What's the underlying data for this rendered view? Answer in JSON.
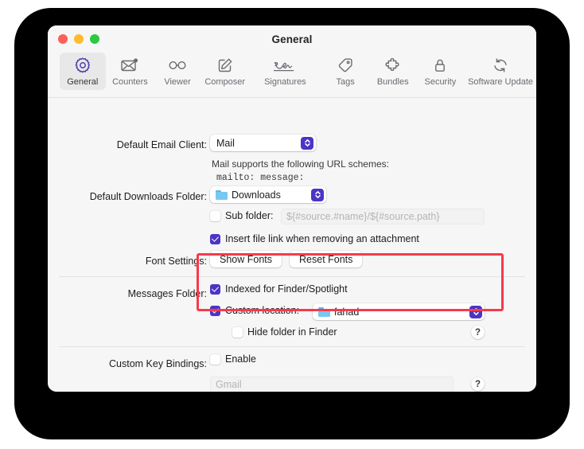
{
  "window": {
    "title": "General",
    "traffic_lights": [
      {
        "name": "close",
        "color": "#fc5f57"
      },
      {
        "name": "minimize",
        "color": "#fdbc2d"
      },
      {
        "name": "zoom",
        "color": "#2bc940"
      }
    ]
  },
  "toolbar": {
    "items": [
      {
        "label": "General",
        "icon": "gear-icon",
        "selected": true
      },
      {
        "label": "Counters",
        "icon": "envelope-badge-icon",
        "selected": false
      },
      {
        "label": "Viewer",
        "icon": "glasses-icon",
        "selected": false
      },
      {
        "label": "Composer",
        "icon": "compose-pencil-icon",
        "selected": false
      },
      {
        "label": "Signatures",
        "icon": "signature-icon",
        "selected": false
      },
      {
        "label": "Tags",
        "icon": "tag-icon",
        "selected": false
      },
      {
        "label": "Bundles",
        "icon": "puzzle-piece-icon",
        "selected": false
      },
      {
        "label": "Security",
        "icon": "lock-icon",
        "selected": false
      },
      {
        "label": "Software Update",
        "icon": "refresh-cycle-icon",
        "selected": false
      }
    ]
  },
  "form": {
    "default_email_client": {
      "label": "Default Email Client:",
      "value": "Mail",
      "note_line1": "Mail supports the following URL schemes:",
      "note_line2": "mailto: message:"
    },
    "default_downloads_folder": {
      "label": "Default Downloads Folder:",
      "value": "Downloads",
      "icon": "folder-icon"
    },
    "sub_folder": {
      "label": "Sub folder:",
      "checked": false,
      "placeholder": "${#source.#name}/${#source.path}"
    },
    "insert_file_link": {
      "label": "Insert file link when removing an attachment",
      "checked": true
    },
    "font_settings": {
      "label": "Font Settings:",
      "show_fonts": "Show Fonts",
      "reset_fonts": "Reset Fonts"
    },
    "messages_folder": {
      "label": "Messages Folder:",
      "indexed": {
        "label": "Indexed for Finder/Spotlight",
        "checked": true
      },
      "custom_location": {
        "label": "Custom location:",
        "checked": true,
        "value": "fahad",
        "icon": "folder-icon"
      },
      "hide_folder": {
        "label": "Hide folder in Finder",
        "checked": false
      },
      "help": "?"
    },
    "custom_key_bindings": {
      "label": "Custom Key Bindings:",
      "enable_label": "Enable",
      "enable_checked": false,
      "placeholder": "Gmail",
      "help": "?"
    }
  },
  "annotation": {
    "highlight_color": "#f9394a",
    "target": "messages-folder-settings"
  }
}
